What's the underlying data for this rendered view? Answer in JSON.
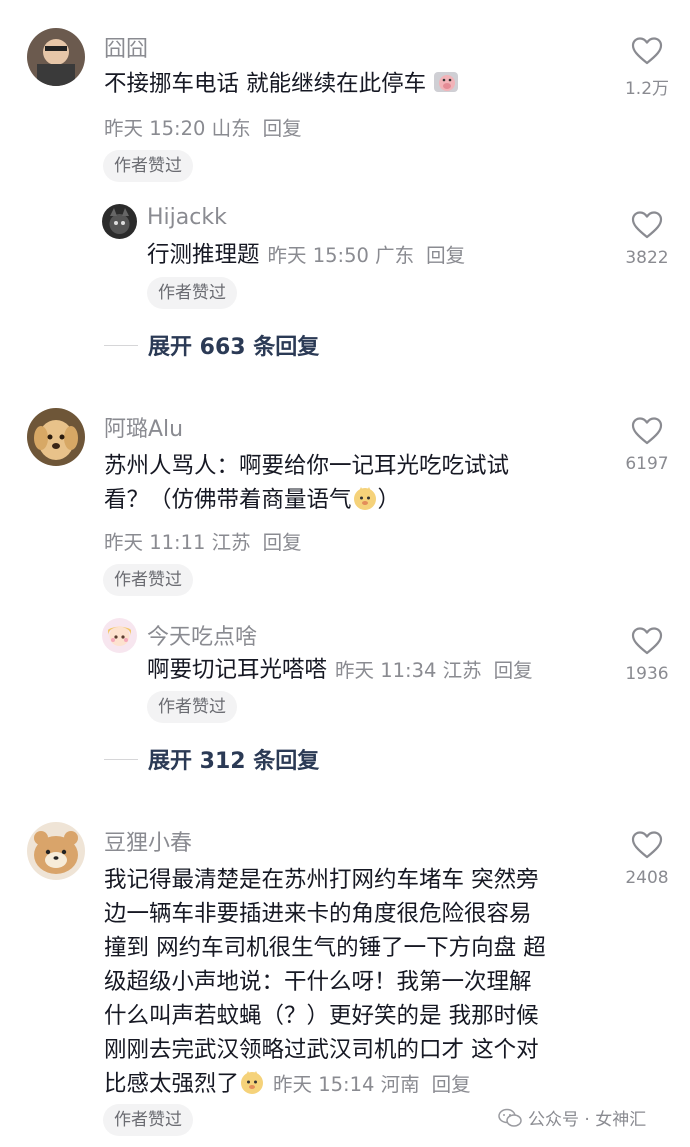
{
  "comments": [
    {
      "username": "囧囧",
      "lines": [
        "不接挪车电话 就能继续在此停车"
      ],
      "time_location": "昨天 15:20 山东",
      "reply_label": "回复",
      "author_badge": "作者赞过",
      "likes": "1.2万",
      "replies": [
        {
          "username": "Hijackk",
          "text": "行测推理题",
          "time_location": "昨天 15:50 广东",
          "reply_label": "回复",
          "author_badge": "作者赞过",
          "likes": "3822"
        }
      ],
      "expand_label": "展开 663 条回复"
    },
    {
      "username": "阿璐Alu",
      "lines": [
        "苏州人骂人：啊要给你一记耳光吃吃试试",
        "看？（仿佛带着商量语气",
        "）"
      ],
      "time_location": "昨天 11:11 江苏",
      "reply_label": "回复",
      "author_badge": "作者赞过",
      "likes": "6197",
      "replies": [
        {
          "username": "今天吃点啥",
          "text": "啊要切记耳光嗒嗒",
          "time_location": "昨天 11:34 江苏",
          "reply_label": "回复",
          "author_badge": "作者赞过",
          "likes": "1936"
        }
      ],
      "expand_label": "展开 312 条回复"
    },
    {
      "username": "豆狸小春",
      "lines": [
        "我记得最清楚是在苏州打网约车堵车 突然旁",
        "边一辆车非要插进来卡的角度很危险很容易",
        "撞到 网约车司机很生气的锤了一下方向盘 超",
        "级超级小声地说：干什么呀！我第一次理解",
        "什么叫声若蚊蝇（？）更好笑的是 我那时候",
        "刚刚去完武汉领略过武汉司机的口才 这个对",
        "比感太强烈了"
      ],
      "time_location": "昨天 15:14 河南",
      "reply_label": "回复",
      "author_badge": "作者赞过",
      "likes": "2408"
    }
  ],
  "watermark": "公众号 · 女神汇",
  "colors": {
    "muted": "#8a8b91",
    "text": "#161823",
    "badge_bg": "#f3f3f4",
    "expand": "#2b3a55"
  }
}
